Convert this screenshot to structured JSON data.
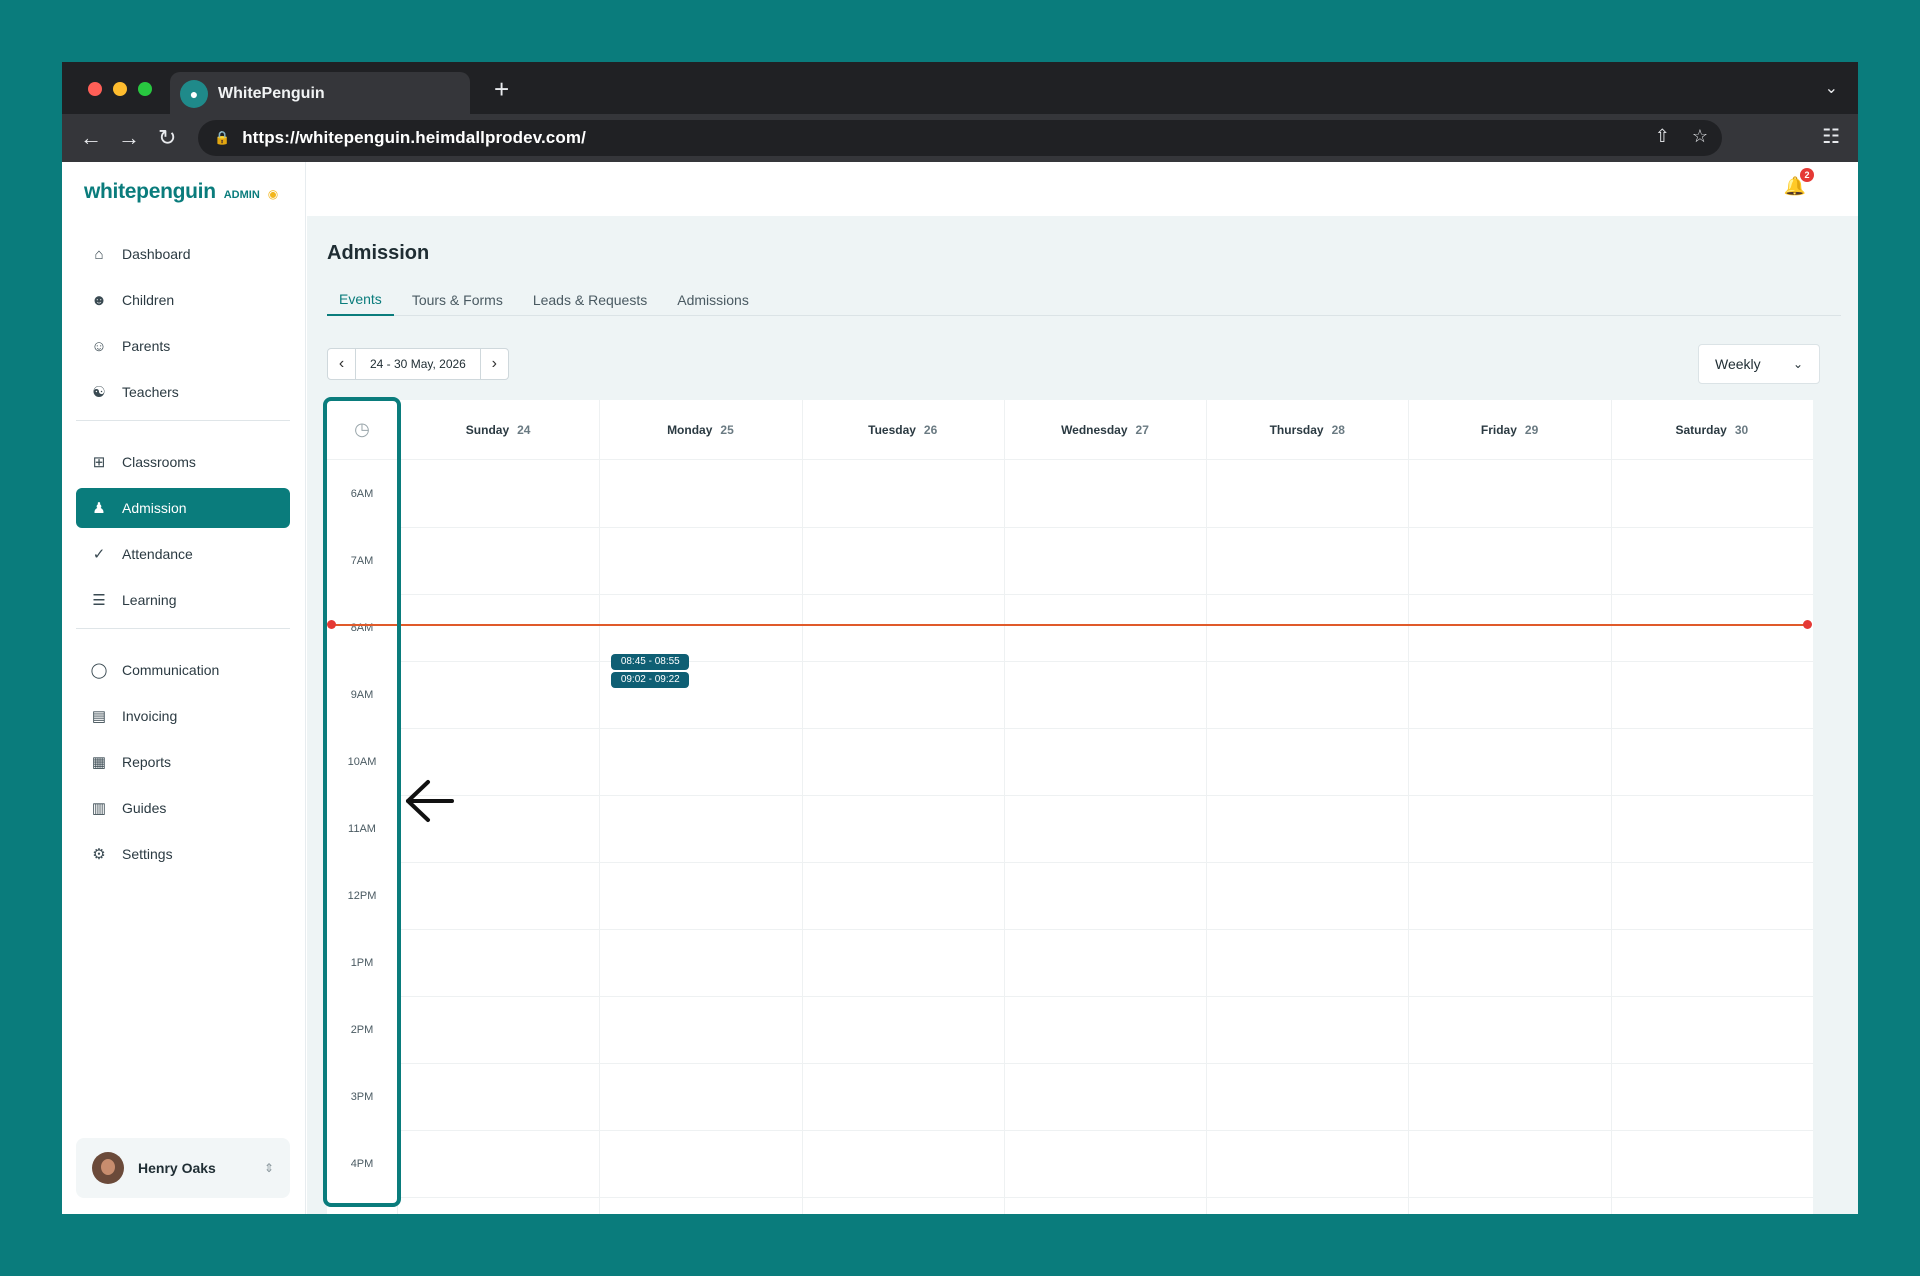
{
  "browser": {
    "tab_title": "WhitePenguin",
    "url": "https://whitepenguin.heimdallprodev.com/"
  },
  "sidebar": {
    "logo": "whitepenguin",
    "admin_label": "ADMIN",
    "items": [
      {
        "label": "Dashboard",
        "icon": "home-icon"
      },
      {
        "label": "Children",
        "icon": "child-icon"
      },
      {
        "label": "Parents",
        "icon": "parents-icon"
      },
      {
        "label": "Teachers",
        "icon": "teacher-icon"
      },
      {
        "label": "Classrooms",
        "icon": "grid-icon"
      },
      {
        "label": "Admission",
        "icon": "user-plus-icon",
        "active": true
      },
      {
        "label": "Attendance",
        "icon": "check-icon"
      },
      {
        "label": "Learning",
        "icon": "book-icon"
      },
      {
        "label": "Communication",
        "icon": "chat-icon"
      },
      {
        "label": "Invoicing",
        "icon": "invoice-icon"
      },
      {
        "label": "Reports",
        "icon": "chart-icon"
      },
      {
        "label": "Guides",
        "icon": "guide-icon"
      },
      {
        "label": "Settings",
        "icon": "gear-icon"
      }
    ],
    "user": {
      "name": "Henry Oaks"
    }
  },
  "topbar": {
    "notification_count": "2"
  },
  "main": {
    "title": "Admission",
    "tabs": [
      {
        "label": "Events",
        "active": true
      },
      {
        "label": "Tours & Forms"
      },
      {
        "label": "Leads & Requests"
      },
      {
        "label": "Admissions"
      }
    ],
    "date_range": "24 - 30 May, 2026",
    "view": "Weekly"
  },
  "calendar": {
    "days": [
      {
        "name": "Sunday",
        "num": "24"
      },
      {
        "name": "Monday",
        "num": "25"
      },
      {
        "name": "Tuesday",
        "num": "26"
      },
      {
        "name": "Wednesday",
        "num": "27"
      },
      {
        "name": "Thursday",
        "num": "28"
      },
      {
        "name": "Friday",
        "num": "29"
      },
      {
        "name": "Saturday",
        "num": "30"
      }
    ],
    "hours": [
      "6AM",
      "7AM",
      "8AM",
      "9AM",
      "10AM",
      "11AM",
      "12PM",
      "1PM",
      "2PM",
      "3PM",
      "4PM"
    ],
    "events": [
      {
        "label": "08:45 - 08:55",
        "day": "Monday"
      },
      {
        "label": "09:02 - 09:22",
        "day": "Monday"
      }
    ]
  },
  "colors": {
    "brand": "#0a7c7c",
    "now_line": "#e05a2a",
    "event": "#0f5f74"
  }
}
